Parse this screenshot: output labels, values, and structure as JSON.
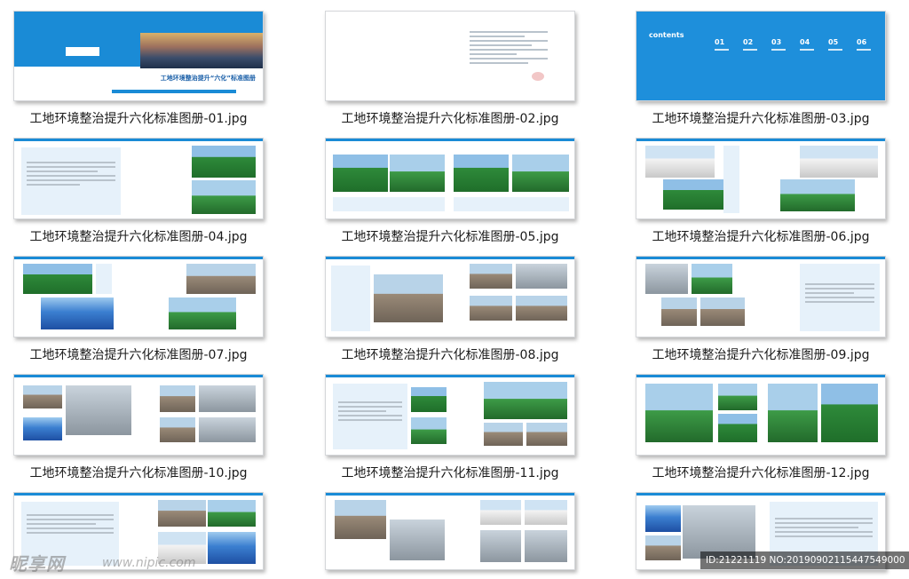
{
  "thumbnails": [
    {
      "caption": "工地环境整治提升六化标准图册-01.jpg"
    },
    {
      "caption": "工地环境整治提升六化标准图册-02.jpg"
    },
    {
      "caption": "工地环境整治提升六化标准图册-03.jpg"
    },
    {
      "caption": "工地环境整治提升六化标准图册-04.jpg"
    },
    {
      "caption": "工地环境整治提升六化标准图册-05.jpg"
    },
    {
      "caption": "工地环境整治提升六化标准图册-06.jpg"
    },
    {
      "caption": "工地环境整治提升六化标准图册-07.jpg"
    },
    {
      "caption": "工地环境整治提升六化标准图册-08.jpg"
    },
    {
      "caption": "工地环境整治提升六化标准图册-09.jpg"
    },
    {
      "caption": "工地环境整治提升六化标准图册-10.jpg"
    },
    {
      "caption": "工地环境整治提升六化标准图册-11.jpg"
    },
    {
      "caption": "工地环境整治提升六化标准图册-12.jpg"
    },
    {
      "caption": ""
    },
    {
      "caption": ""
    },
    {
      "caption": ""
    }
  ],
  "cover": {
    "title": "工地环境整治提升“六化”标准图册"
  },
  "contents_page": {
    "heading": "contents",
    "numbers": [
      "01",
      "02",
      "03",
      "04",
      "05",
      "06"
    ]
  },
  "watermark": {
    "logo_text": "昵享网",
    "url": "www.nipic.com"
  },
  "image_id": "ID:21221119 NO:20190902115447549000",
  "colors": {
    "brand_blue": "#1a8bd6",
    "caption_text": "#1a1a1a"
  }
}
